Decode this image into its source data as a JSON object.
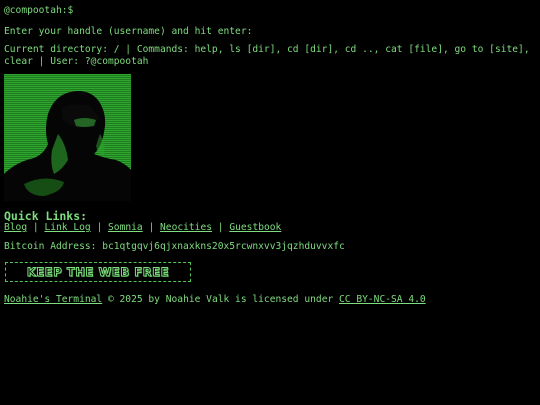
{
  "terminal": {
    "prompt": "@compootah:$",
    "enter_prompt": "Enter your handle (username) and hit enter:",
    "info": "Current directory: / | Commands: help, ls [dir], cd [dir], cd .., cat [file], go to [site], clear | User: ?@compootah"
  },
  "portrait": {
    "description_icon": "portrait-photo",
    "tint_color": "#2ea52e"
  },
  "quick_links": {
    "title": "Quick Links:",
    "items": [
      {
        "label": "Blog"
      },
      {
        "label": "Link Log"
      },
      {
        "label": "Somnia"
      },
      {
        "label": "Neocities"
      },
      {
        "label": "Guestbook"
      }
    ],
    "separator": "|"
  },
  "bitcoin": {
    "text": "Bitcoin Address: bc1qtgqvj6qjxnaxkns20x5rcwnxvv3jqzhduvvxfc"
  },
  "badge": {
    "label": "KEEP THE WEB FREE"
  },
  "footer": {
    "site_link": "Noahie's Terminal",
    "middle": " © 2025 by Noahie Valk is licensed under ",
    "license_link": "CC BY-NC-SA 4.0"
  },
  "colors": {
    "background": "#000000",
    "text": "#7fdc7f",
    "accent": "#2ea52e"
  }
}
